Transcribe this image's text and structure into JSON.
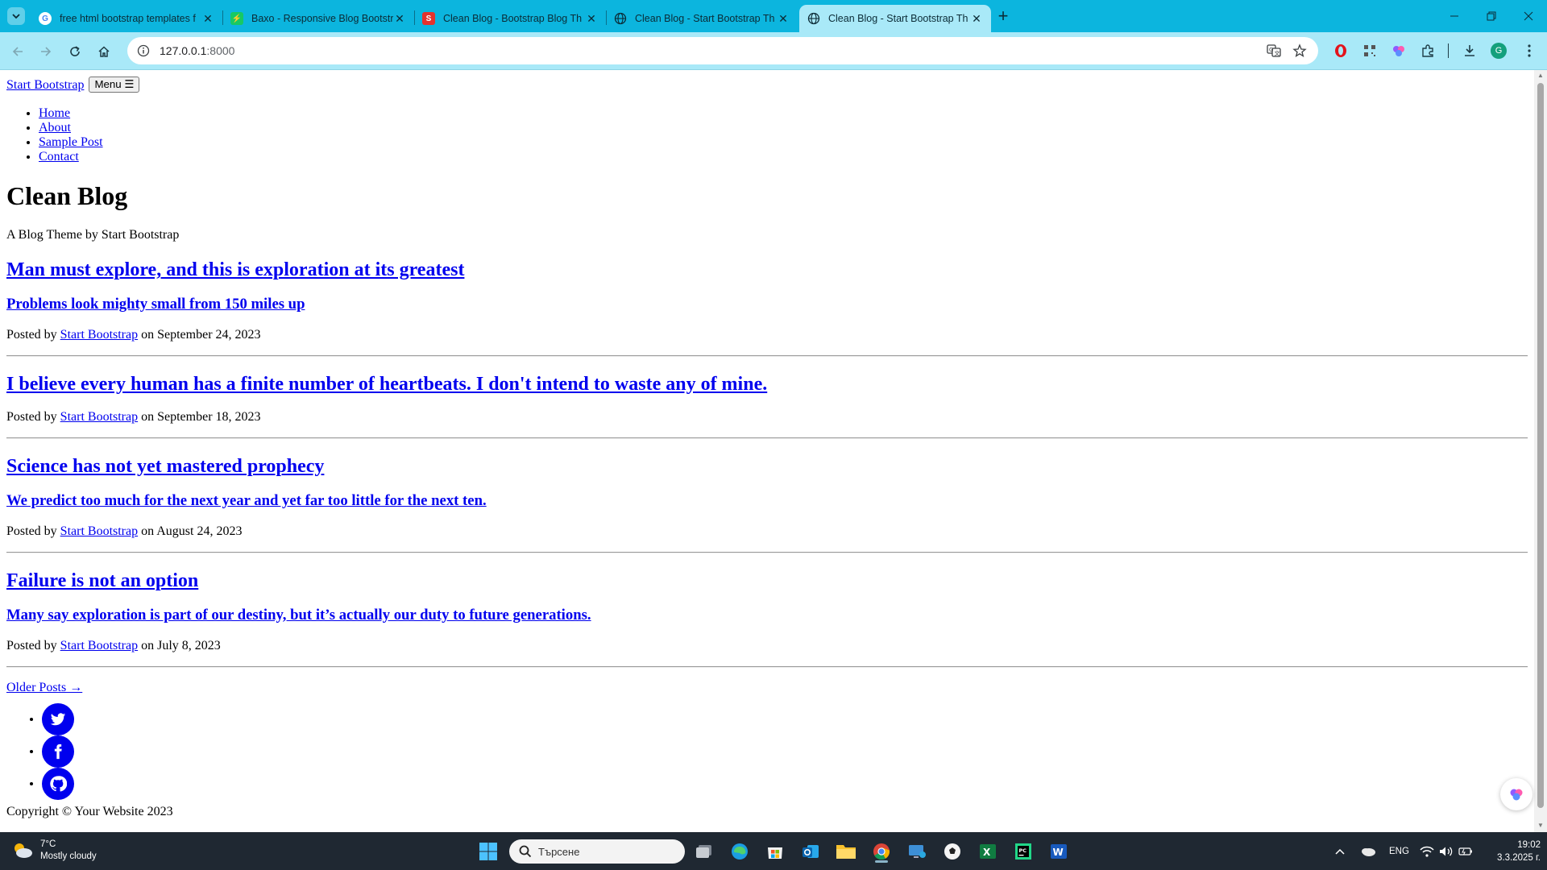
{
  "browser": {
    "tabs": [
      {
        "title": "free html bootstrap templates f",
        "favicon": "google-icon"
      },
      {
        "title": "Baxo - Responsive Blog Bootstr",
        "favicon": "baxo-icon"
      },
      {
        "title": "Clean Blog - Bootstrap Blog Th",
        "favicon": "s-logo-icon"
      },
      {
        "title": "Clean Blog - Start Bootstrap Th",
        "favicon": "globe-icon"
      },
      {
        "title": "Clean Blog - Start Bootstrap Th",
        "favicon": "globe-icon",
        "active": true
      }
    ],
    "url_host": "127.0.0.1",
    "url_port": ":8000",
    "accent_color": "#0cb5de",
    "toolbar_color": "#a9e9f8",
    "profile_initial": "G"
  },
  "page": {
    "brand": "Start Bootstrap",
    "menu_label": "Menu",
    "nav": [
      "Home",
      "About",
      "Sample Post",
      "Contact"
    ],
    "heading": "Clean Blog",
    "subheading": "A Blog Theme by Start Bootstrap",
    "posts": [
      {
        "title": "Man must explore, and this is exploration at its greatest",
        "subtitle": "Problems look mighty small from 150 miles up",
        "posted_by": "Posted by",
        "author": "Start Bootstrap",
        "date_text": "on September 24, 2023"
      },
      {
        "title": "I believe every human has a finite number of heartbeats. I don't intend to waste any of mine.",
        "subtitle": "",
        "posted_by": "Posted by",
        "author": "Start Bootstrap",
        "date_text": "on September 18, 2023"
      },
      {
        "title": "Science has not yet mastered prophecy",
        "subtitle": "We predict too much for the next year and yet far too little for the next ten.",
        "posted_by": "Posted by",
        "author": "Start Bootstrap",
        "date_text": "on August 24, 2023"
      },
      {
        "title": "Failure is not an option",
        "subtitle": "Many say exploration is part of our destiny, but it’s actually our duty to future generations.",
        "posted_by": "Posted by",
        "author": "Start Bootstrap",
        "date_text": "on July 8, 2023"
      }
    ],
    "older_posts": "Older Posts →",
    "social": [
      "twitter-icon",
      "facebook-icon",
      "github-icon"
    ],
    "copyright": "Copyright © Your Website 2023",
    "link_color": "#0000ee"
  },
  "taskbar": {
    "weather_temp": "7°C",
    "weather_desc": "Mostly cloudy",
    "search_placeholder": "Търсене",
    "language": "ENG",
    "time": "19:02",
    "date": "3.3.2025 г."
  }
}
